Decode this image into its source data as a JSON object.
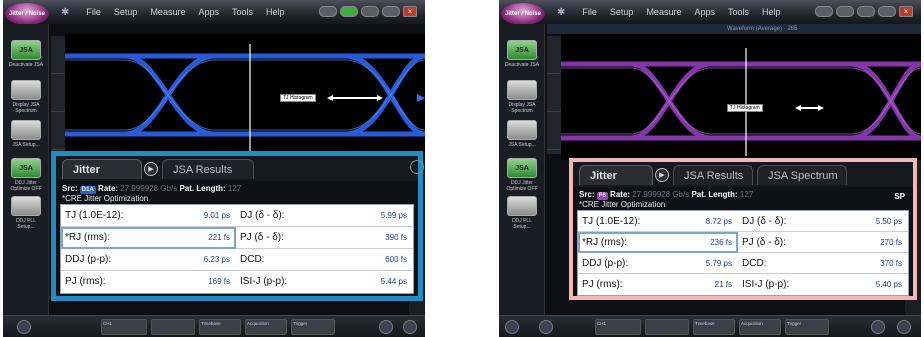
{
  "panels": [
    {
      "app_logo": "Jitter / Noise",
      "menu": [
        "File",
        "Setup",
        "Measure",
        "Apps",
        "Tools",
        "Help"
      ],
      "waveform_title": "",
      "sidebar": [
        {
          "icon": "JSA",
          "label": "Deactivate JSA"
        },
        {
          "icon": "",
          "label": "Display JSA Spectrum"
        },
        {
          "icon": "",
          "label": "JSA Setup..."
        },
        {
          "icon": "JSA",
          "label": "DDJ Jitter Optimize OFF"
        },
        {
          "icon": "",
          "label": "DDJ PLL Setup..."
        }
      ],
      "tj_histogram": "TJ Histogram",
      "tabs": [
        "Jitter",
        "JSA Results"
      ],
      "src_label": "Src:",
      "src_badge": "D1A",
      "rate_label": "Rate:",
      "rate_value": "27.999928 Gb/s",
      "pat_label": "Pat. Length:",
      "pat_value": "127",
      "sp_badge": "",
      "cre": "*CRE Jitter Optimization",
      "rows": [
        [
          {
            "label": "TJ (1.0E-12):",
            "value": "9.01 ps"
          },
          {
            "label": "DJ (δ - δ):",
            "value": "5.99 ps"
          }
        ],
        [
          {
            "label": "*RJ (rms):",
            "value": "221 fs"
          },
          {
            "label": "PJ (δ - δ):",
            "value": "390 fs"
          }
        ],
        [
          {
            "label": "DDJ (p-p):",
            "value": "6.23 ps"
          },
          {
            "label": "DCD:",
            "value": "600 fs"
          }
        ],
        [
          {
            "label": "PJ (rms):",
            "value": "169 fs"
          },
          {
            "label": "ISI-J (p-p):",
            "value": "5.44 ps"
          }
        ]
      ]
    },
    {
      "app_logo": "Jitter / Noise",
      "menu": [
        "File",
        "Setup",
        "Measure",
        "Apps",
        "Tools",
        "Help"
      ],
      "waveform_title": "Waveform (Average) · 265",
      "sidebar": [
        {
          "icon": "JSA",
          "label": "Deactivate JSA"
        },
        {
          "icon": "",
          "label": "Display JSA Spectrum"
        },
        {
          "icon": "",
          "label": "JSA Setup..."
        },
        {
          "icon": "JSA",
          "label": "DDJ Jitter Optimize OFF"
        },
        {
          "icon": "",
          "label": "DDJ PLL Setup..."
        }
      ],
      "tj_histogram": "TJ Histogram",
      "tabs": [
        "Jitter",
        "JSA Results",
        "JSA Spectrum"
      ],
      "src_label": "Src:",
      "src_badge": "F6",
      "rate_label": "Rate:",
      "rate_value": "27.999928 Gb/s",
      "pat_label": "Pat. Length:",
      "pat_value": "127",
      "sp_badge": "SP",
      "cre": "*CRE Jitter Optimization",
      "rows": [
        [
          {
            "label": "TJ (1.0E-12):",
            "value": "8.72 ps"
          },
          {
            "label": "DJ (δ - δ):",
            "value": "5.50 ps"
          }
        ],
        [
          {
            "label": "*RJ (rms):",
            "value": "236 fs"
          },
          {
            "label": "PJ (δ - δ):",
            "value": "270 fs"
          }
        ],
        [
          {
            "label": "DDJ (p-p):",
            "value": "5.79 ps"
          },
          {
            "label": "DCD:",
            "value": "370 fs"
          }
        ],
        [
          {
            "label": "PJ (rms):",
            "value": "21 fs"
          },
          {
            "label": "ISI-J (p-p):",
            "value": "5.40 ps"
          }
        ]
      ]
    }
  ],
  "bottom_bar": [
    "CH1",
    "Acquisition",
    "Trigger",
    "Timebase"
  ],
  "colors": {
    "eye_left": "#2f6cff",
    "eye_right": "#9b40c8",
    "overlay_border_left": "#1f8ec6",
    "overlay_border_right": "#f2b7b7",
    "badge_left": "#2a64c8",
    "badge_right": "#9b40c8"
  }
}
